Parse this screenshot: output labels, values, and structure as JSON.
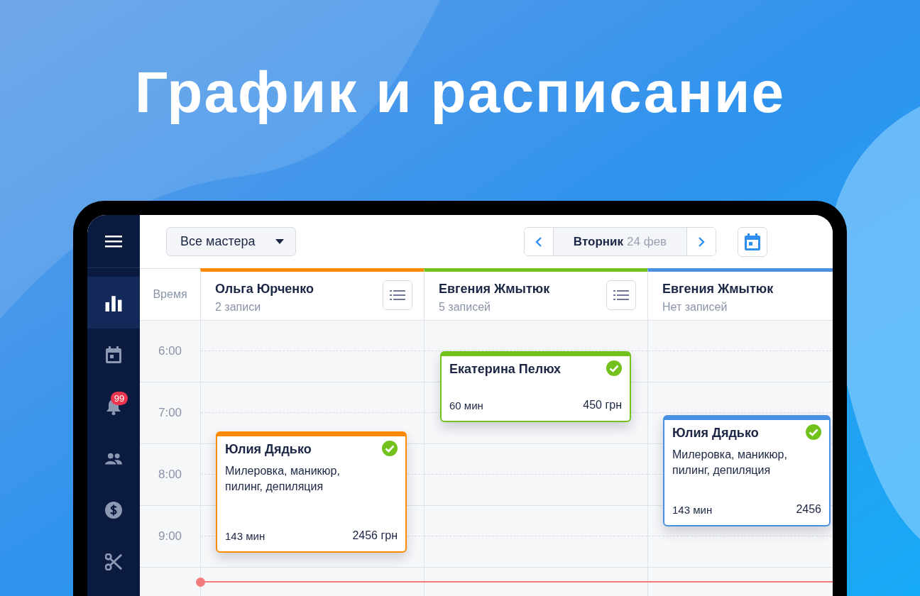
{
  "headline": "График и расписание",
  "sidebar": {
    "items": [
      {
        "kind": "chart",
        "selected": true
      },
      {
        "kind": "calendar",
        "selected": false
      },
      {
        "kind": "bell",
        "selected": false,
        "badge": "99"
      },
      {
        "kind": "people",
        "selected": false
      },
      {
        "kind": "dollar",
        "selected": false
      },
      {
        "kind": "scissors",
        "selected": false
      }
    ]
  },
  "toolbar": {
    "master_filter": "Все мастера",
    "day": "Вторник",
    "date": "24 фев"
  },
  "time_header": "Время",
  "hours": [
    "6:00",
    "7:00",
    "8:00",
    "9:00"
  ],
  "columns": [
    {
      "name": "Ольга Юрченко",
      "count": "2 записи",
      "color": "#ff8a00",
      "list_button": true,
      "appointments": [
        {
          "client": "Юлия Дядько",
          "services": "Милеровка, маникюр, пилинг, депиляция",
          "duration": "143 мин",
          "price": "2456 грн",
          "confirmed": true
        }
      ]
    },
    {
      "name": "Евгения Жмытюк",
      "count": "5 записей",
      "color": "#72c11c",
      "list_button": true,
      "appointments": [
        {
          "client": "Екатерина Пелюх",
          "duration": "60 мин",
          "price": "450 грн",
          "confirmed": true
        }
      ]
    },
    {
      "name": "Евгения Жмытюк",
      "count": "Нет записей",
      "color": "#4a90e2",
      "list_button": false,
      "appointments": [
        {
          "client": "Юлия Дядько",
          "services": "Милеровка, маникюр, пилинг, депиляция",
          "duration": "143 мин",
          "price": "2456",
          "confirmed": true
        }
      ]
    }
  ]
}
